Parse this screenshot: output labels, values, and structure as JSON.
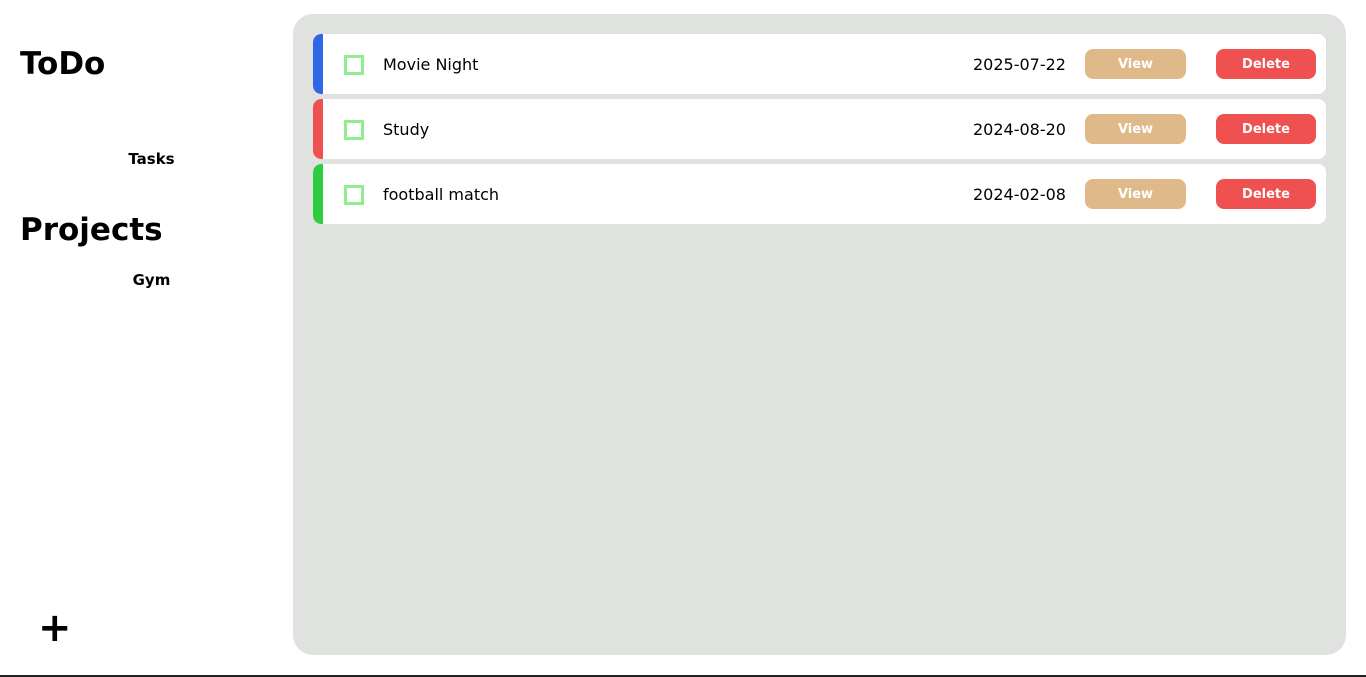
{
  "sidebar": {
    "app_title": "ToDo",
    "tasks_label": "Tasks",
    "projects_title": "Projects",
    "projects": [
      "Gym"
    ],
    "add_label": "+"
  },
  "tasks": [
    {
      "title": "Movie Night",
      "date": "2025-07-22",
      "priority_color": "#2f67e8",
      "view_label": "View",
      "delete_label": "Delete",
      "checked": false
    },
    {
      "title": "Study",
      "date": "2024-08-20",
      "priority_color": "#ef5050",
      "view_label": "View",
      "delete_label": "Delete",
      "checked": false
    },
    {
      "title": "football match",
      "date": "2024-02-08",
      "priority_color": "#2ecc40",
      "view_label": "View",
      "delete_label": "Delete",
      "checked": false
    }
  ],
  "colors": {
    "main_bg": "#e0e2df",
    "view_button": "#e0b98a",
    "delete_button": "#ef5050",
    "checkbox_border": "#90ee90"
  }
}
